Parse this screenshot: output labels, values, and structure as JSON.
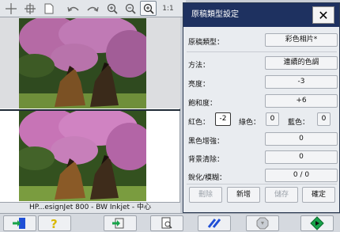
{
  "toolbar": {
    "icons": [
      "crosshair-icon",
      "move-icon",
      "page-icon",
      "undo-icon",
      "redo-icon",
      "zoom-in-icon",
      "zoom-out-icon",
      "zoom-fit-icon",
      "actual-size-icon"
    ],
    "actual_size_label": "1:1"
  },
  "status": {
    "printer": "HP...esignJet 800 - BW Inkjet - 中心"
  },
  "dialog": {
    "title": "原稿類型設定",
    "rows": {
      "original_type": {
        "label": "原稿類型：",
        "value": "彩色相片*"
      },
      "method": {
        "label": "方法：",
        "value": "連續的色調"
      },
      "brightness": {
        "label": "亮度：",
        "value": "-3"
      },
      "saturation": {
        "label": "飽和度：",
        "value": "+6"
      },
      "red": {
        "label": "紅色：",
        "value": "-2"
      },
      "green": {
        "label": "綠色：",
        "value": "0"
      },
      "blue": {
        "label": "藍色：",
        "value": "0"
      },
      "black_enhance": {
        "label": "黑色增強：",
        "value": "0"
      },
      "bg_remove": {
        "label": "背景清除：",
        "value": "0"
      },
      "sharp_blur": {
        "label": "銳化/模糊：",
        "value": "0 / 0"
      }
    },
    "buttons": {
      "delete": "刪除",
      "new": "新增",
      "save": "儲存",
      "ok": "確定"
    }
  },
  "colors": {
    "title_bar": "#1e3160",
    "accent_green": "#17a34a",
    "accent_blue": "#1f4fd6",
    "accent_yellow": "#e6c200"
  }
}
